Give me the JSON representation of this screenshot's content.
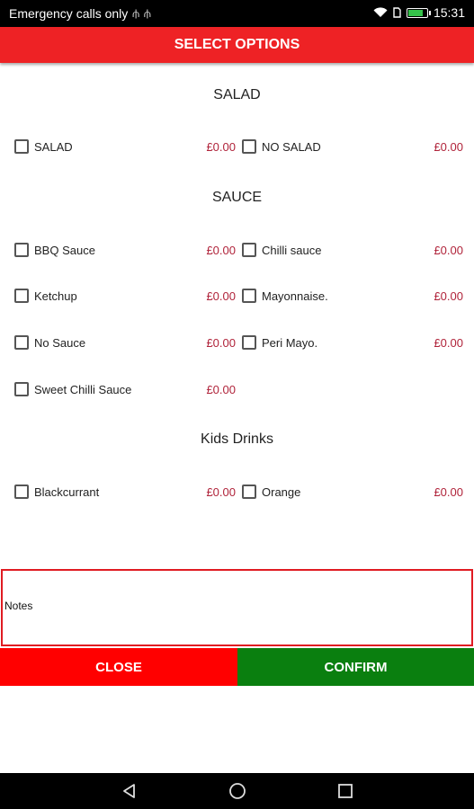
{
  "status_bar": {
    "carrier_text": "Emergency calls only",
    "time": "15:31",
    "battery_level": 0.85
  },
  "header": {
    "title": "SELECT OPTIONS"
  },
  "sections": [
    {
      "title": "SALAD",
      "options": [
        {
          "label": "SALAD",
          "price": "£0.00"
        },
        {
          "label": "NO SALAD",
          "price": "£0.00"
        }
      ]
    },
    {
      "title": "SAUCE",
      "options": [
        {
          "label": "BBQ Sauce",
          "price": "£0.00"
        },
        {
          "label": "Chilli sauce",
          "price": "£0.00"
        },
        {
          "label": "Ketchup",
          "price": "£0.00"
        },
        {
          "label": "Mayonnaise.",
          "price": "£0.00"
        },
        {
          "label": "No Sauce",
          "price": "£0.00"
        },
        {
          "label": "Peri Mayo.",
          "price": "£0.00"
        },
        {
          "label": "Sweet Chilli Sauce",
          "price": "£0.00"
        }
      ]
    },
    {
      "title": "Kids Drinks",
      "options": [
        {
          "label": "Blackcurrant",
          "price": "£0.00"
        },
        {
          "label": "Orange",
          "price": "£0.00"
        }
      ]
    }
  ],
  "notes": {
    "label": "Notes"
  },
  "buttons": {
    "close": "CLOSE",
    "confirm": "CONFIRM"
  },
  "icons": {
    "nav": [
      "back-icon",
      "home-icon",
      "recents-icon"
    ],
    "status": [
      "signal-icon",
      "wifi-icon",
      "battery-icon"
    ]
  }
}
